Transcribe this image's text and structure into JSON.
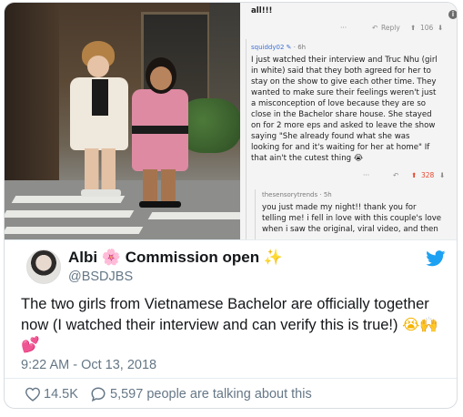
{
  "tweet": {
    "author_name": "Albi",
    "author_emoji_flower": "🌸",
    "author_name_suffix": "Commission open",
    "author_emoji_sparkles": "✨",
    "handle": "@BSDJBS",
    "text_line1": "The two girls from Vietnamese Bachelor are officially together",
    "text_line2": "now (I watched their interview and can verify this is true!)",
    "text_emojis": "😭🙌",
    "text_line3": "💕",
    "timestamp": "9:22 AM - Oct 13, 2018",
    "likes": "14.5K",
    "talking": "5,597 people are talking about this",
    "accent_color": "#1da1f2",
    "like_icon": "heart-outline-icon",
    "reply_icon": "speech-bubble-icon",
    "brand_icon": "twitter-bird-icon"
  },
  "reddit": {
    "top_text": "all!!!",
    "top_bar": {
      "dots": "···",
      "reply": "Reply",
      "score": "106"
    },
    "comment1": {
      "user": "squiddy02",
      "age": "· 6h",
      "lines": [
        "I just watched their interview and Truc Nhu (girl",
        "in white) said that they both agreed for her to",
        "stay on the show to give each other time. They",
        "wanted to make sure their feelings weren't just",
        "a misconception of love because they are so",
        "close in the Bachelor share house. She stayed",
        "on for 2 more eps and asked to leave the show",
        "saying \"She already found what she was",
        "looking for and it's waiting for her at home\" If",
        "that ain't the cutest thing 😭"
      ],
      "bar": {
        "dots": "···",
        "score": "328"
      }
    },
    "comment2": {
      "user": "thesensorytrends",
      "age": "· 5h",
      "lines": [
        "you just made my night!! thank you for",
        "telling me! i fell in love with this couple's love",
        "when i saw the original, viral video, and then"
      ]
    }
  }
}
